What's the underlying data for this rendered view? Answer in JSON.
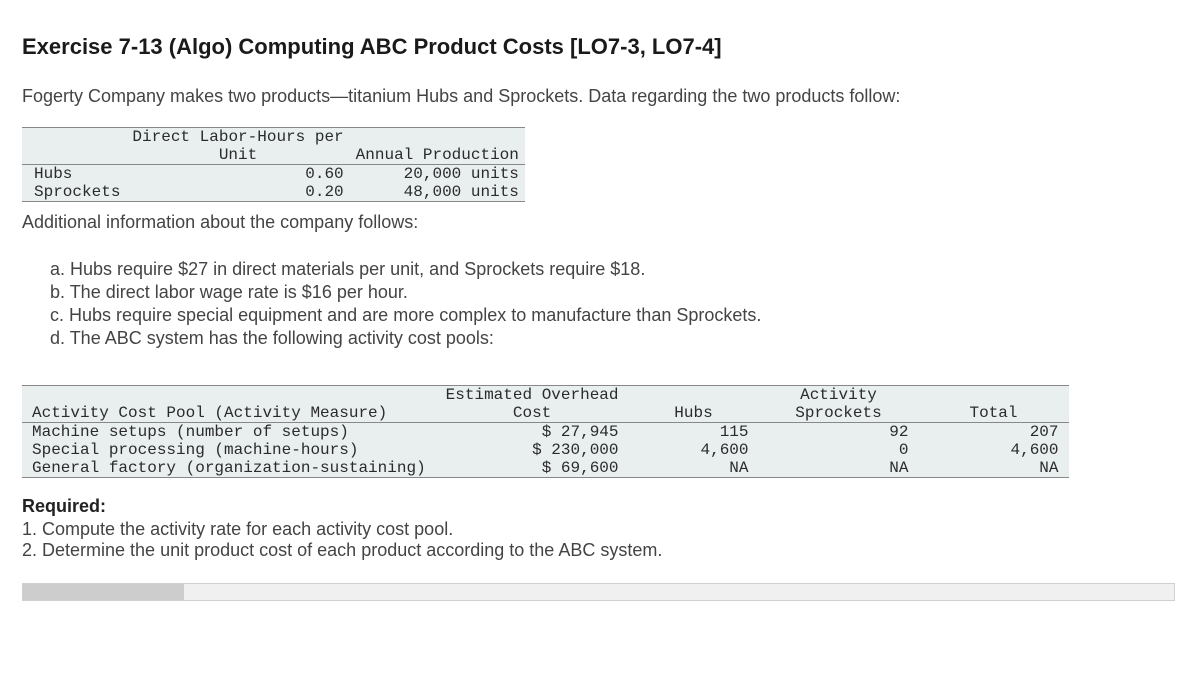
{
  "title": "Exercise 7-13 (Algo) Computing ABC Product Costs [LO7-3, LO7-4]",
  "intro": "Fogerty Company makes two products—titanium Hubs and Sprockets. Data regarding the two products follow:",
  "table1": {
    "col1_header_top": "Direct Labor-Hours per",
    "col1_header_bot": "Unit",
    "col2_header": "Annual Production",
    "rows": [
      {
        "label": "Hubs",
        "dlh": "0.60",
        "prod": "20,000 units"
      },
      {
        "label": "Sprockets",
        "dlh": "0.20",
        "prod": "48,000 units"
      }
    ]
  },
  "subhead": "Additional information about the company follows:",
  "info": {
    "a": "a. Hubs require $27 in direct materials per unit, and Sprockets require $18.",
    "b": "b. The direct labor wage rate is $16 per hour.",
    "c": "c. Hubs require special equipment and are more complex to manufacture than Sprockets.",
    "d": "d. The ABC system has the following activity cost pools:"
  },
  "table2": {
    "h_pool": "Activity Cost Pool (Activity Measure)",
    "h_cost_top": "Estimated Overhead",
    "h_cost_bot": "Cost",
    "h_act_top": "Activity",
    "h_hubs": "Hubs",
    "h_spr": "Sprockets",
    "h_total": "Total",
    "rows": [
      {
        "pool": "Machine setups (number of setups)",
        "cost": "$ 27,945",
        "hubs": "115",
        "spr": "92",
        "total": "207"
      },
      {
        "pool": "Special processing (machine-hours)",
        "cost": "$ 230,000",
        "hubs": "4,600",
        "spr": "0",
        "total": "4,600"
      },
      {
        "pool": "General factory (organization-sustaining)",
        "cost": "$ 69,600",
        "hubs": "NA",
        "spr": "NA",
        "total": "NA"
      }
    ]
  },
  "required": {
    "head": "Required:",
    "r1": "1. Compute the activity rate for each activity cost pool.",
    "r2": "2. Determine the unit product cost of each product according to the ABC system."
  }
}
